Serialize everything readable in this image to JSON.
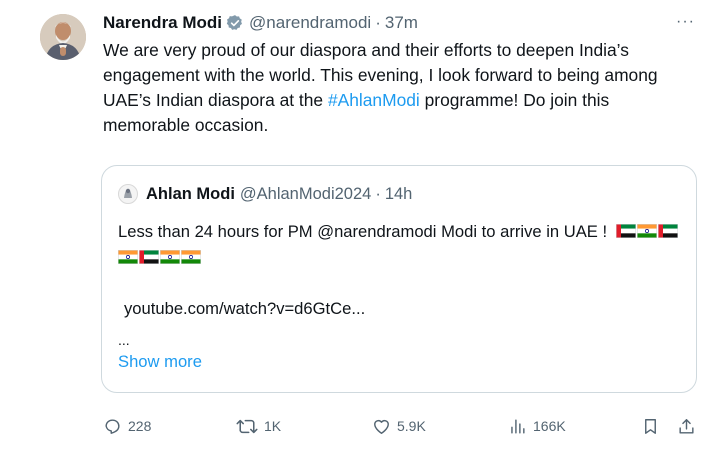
{
  "author": {
    "name": "Narendra Modi",
    "handle": "@narendramodi",
    "separator": "·",
    "time": "37m"
  },
  "more_menu": "···",
  "tweet_text": {
    "before_hashtag": "We are very proud of our diaspora and their efforts to deepen India’s engagement with the world. This evening, I look forward to being among UAE’s Indian diaspora at the ",
    "hashtag": "#AhlanModi",
    "after_hashtag": " programme! Do join this memorable occasion."
  },
  "quoted": {
    "name": "Ahlan Modi",
    "handle": "@AhlanModi2024",
    "separator": "·",
    "time": "14h",
    "text": "Less than 24 hours for PM @narendramodi Modi to arrive in UAE !",
    "flags": [
      "uae",
      "india",
      "uae",
      "india",
      "uae",
      "india",
      "india"
    ],
    "link": "youtube.com/watch?v=d6GtCe...",
    "ellipsis": "...",
    "show_more": "Show more"
  },
  "actions": {
    "replies": "228",
    "reposts": "1K",
    "likes": "5.9K",
    "views": "166K"
  },
  "icons": {
    "verified": "verified-badge-icon",
    "reply": "reply-icon",
    "repost": "repost-icon",
    "like": "heart-icon",
    "views": "views-icon",
    "bookmark": "bookmark-icon",
    "share": "share-icon"
  },
  "colors": {
    "accent": "#1d9bf0",
    "secondary_text": "#536471",
    "border": "#cfd9de"
  }
}
